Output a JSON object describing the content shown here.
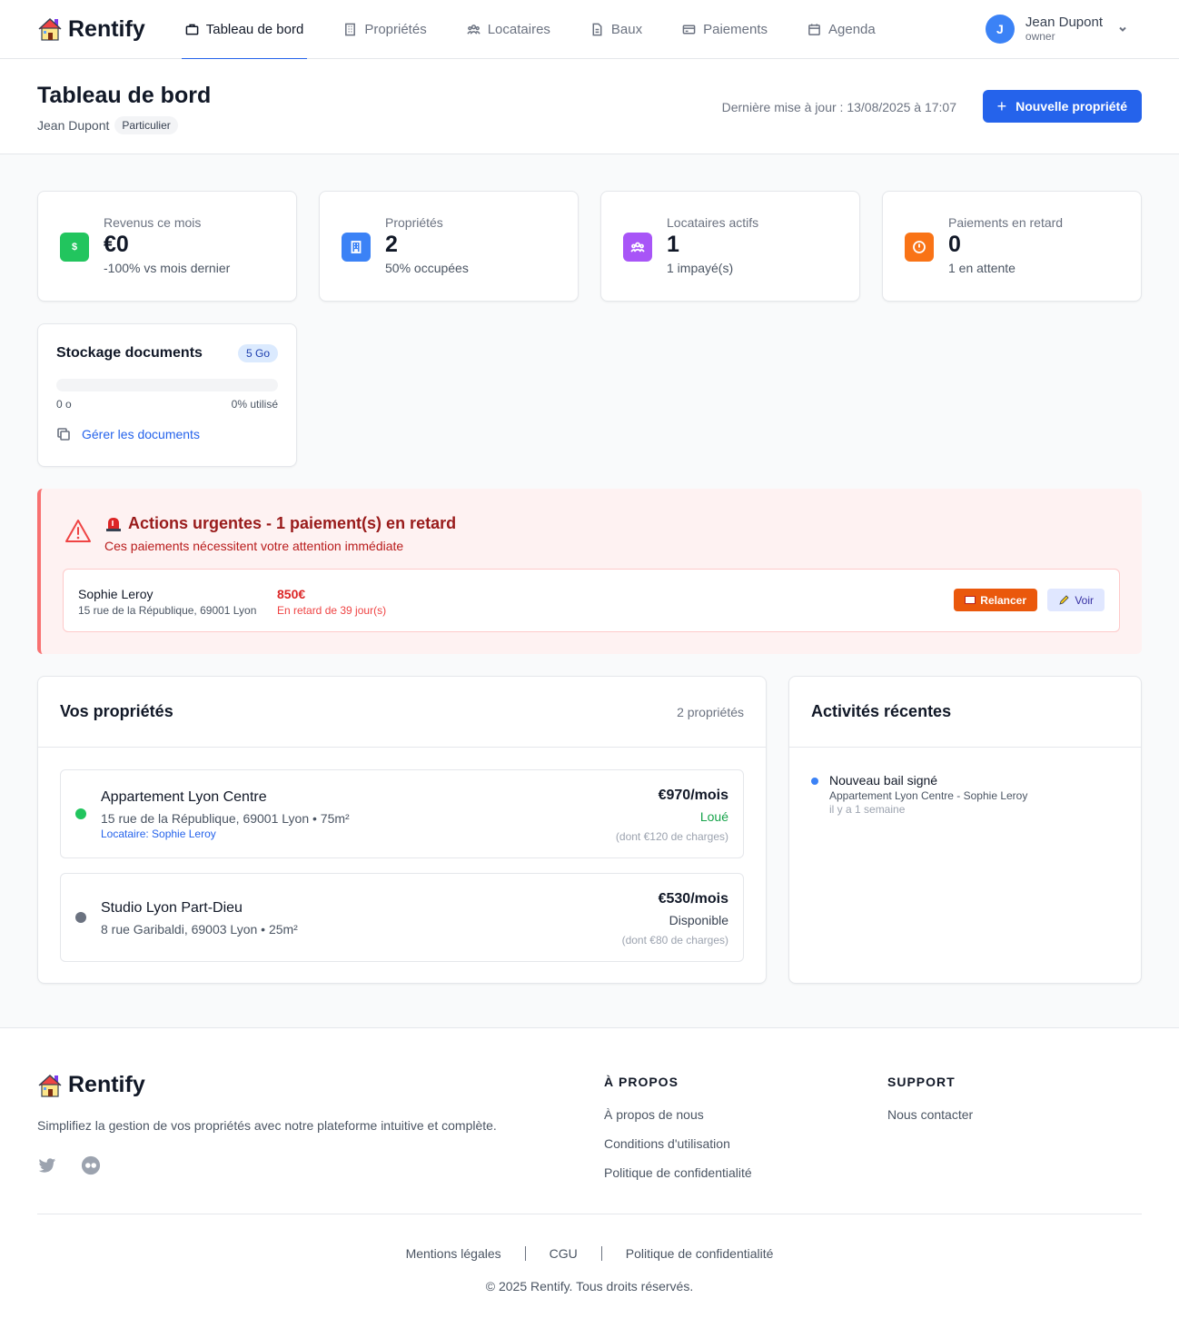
{
  "app": {
    "name": "Rentify"
  },
  "nav": {
    "tabs": [
      {
        "label": "Tableau de bord",
        "icon": "briefcase-icon"
      },
      {
        "label": "Propriétés",
        "icon": "building-icon"
      },
      {
        "label": "Locataires",
        "icon": "users-icon"
      },
      {
        "label": "Baux",
        "icon": "document-icon"
      },
      {
        "label": "Paiements",
        "icon": "credit-card-icon"
      },
      {
        "label": "Agenda",
        "icon": "calendar-icon"
      }
    ],
    "user": {
      "initial": "J",
      "name": "Jean Dupont",
      "role": "owner"
    }
  },
  "header": {
    "title": "Tableau de bord",
    "owner": "Jean Dupont",
    "owner_type": "Particulier",
    "last_update": "Dernière mise à jour : 13/08/2025 à 17:07",
    "new_property_button": "Nouvelle propriété"
  },
  "stats": [
    {
      "label": "Revenus ce mois",
      "value": "€0",
      "sub": "-100% vs mois dernier",
      "icon": "dollar-icon",
      "color": "#22c55e"
    },
    {
      "label": "Propriétés",
      "value": "2",
      "sub": "50% occupées",
      "icon": "building-icon",
      "color": "#3b82f6"
    },
    {
      "label": "Locataires actifs",
      "value": "1",
      "sub": "1 impayé(s)",
      "icon": "users-icon",
      "color": "#a855f7"
    },
    {
      "label": "Paiements en retard",
      "value": "0",
      "sub": "1 en attente",
      "icon": "alert-circle-icon",
      "color": "#f97316"
    }
  ],
  "storage": {
    "title": "Stockage documents",
    "quota": "5 Go",
    "used": "0 o",
    "percent_label": "0% utilisé",
    "used_fraction": 0,
    "manage_link": "Gérer les documents"
  },
  "alert": {
    "title": "Actions urgentes - 1 paiement(s) en retard",
    "subtitle": "Ces paiements nécessitent votre attention immédiate",
    "items": [
      {
        "tenant": "Sophie Leroy",
        "address": "15 rue de la République, 69001 Lyon",
        "amount": "850€",
        "late": "En retard de 39 jour(s)",
        "remind_button": "Relancer",
        "view_button": "Voir"
      }
    ]
  },
  "properties": {
    "title": "Vos propriétés",
    "count": "2 propriétés",
    "items": [
      {
        "name": "Appartement Lyon Centre",
        "address": "15 rue de la République, 69001 Lyon • 75m²",
        "tenant": "Locataire: Sophie Leroy",
        "price": "€970/mois",
        "status": "Loué",
        "status_color": "#16a34a",
        "dot_color": "#22c55e",
        "charges": "(dont €120 de charges)"
      },
      {
        "name": "Studio Lyon Part-Dieu",
        "address": "8 rue Garibaldi, 69003 Lyon • 25m²",
        "tenant": "",
        "price": "€530/mois",
        "status": "Disponible",
        "status_color": "#374151",
        "dot_color": "#6b7280",
        "charges": "(dont €80 de charges)"
      }
    ]
  },
  "activities": {
    "title": "Activités récentes",
    "items": [
      {
        "title": "Nouveau bail signé",
        "detail": "Appartement Lyon Centre - Sophie Leroy",
        "time": "il y a 1 semaine"
      }
    ]
  },
  "footer": {
    "description": "Simplifiez la gestion de vos propriétés avec notre plateforme intuitive et complète.",
    "about": {
      "title": "À PROPOS",
      "links": [
        "À propos de nous",
        "Conditions d'utilisation",
        "Politique de confidentialité"
      ]
    },
    "support": {
      "title": "SUPPORT",
      "links": [
        "Nous contacter"
      ]
    },
    "legal": [
      "Mentions légales",
      "CGU",
      "Politique de confidentialité"
    ],
    "copyright": "© 2025 Rentify. Tous droits réservés."
  }
}
